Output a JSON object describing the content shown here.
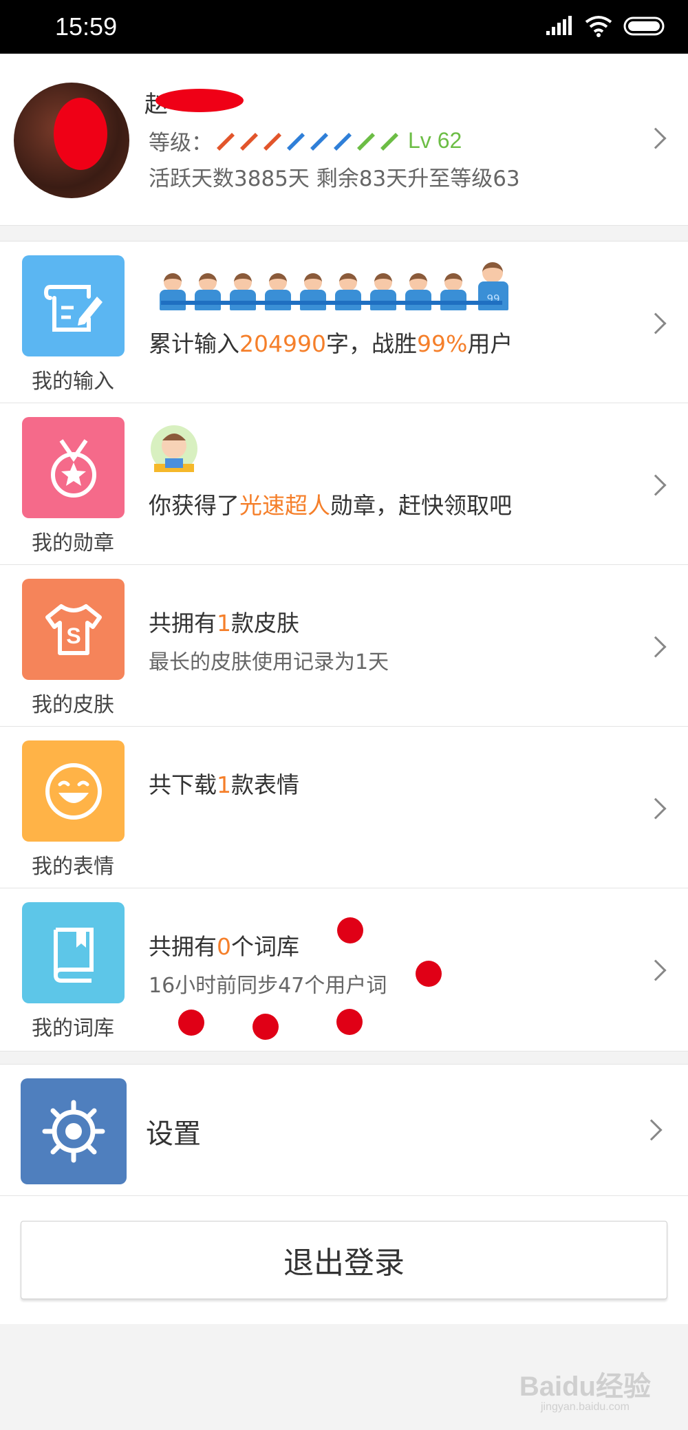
{
  "status_bar": {
    "time": "15:59"
  },
  "profile": {
    "name": "赵",
    "level_label": "等级：",
    "level_value": "Lv 62",
    "active_text": "活跃天数3885天 剩余83天升至等级63"
  },
  "menu": [
    {
      "label": "我的输入",
      "title_parts": [
        "累计输入",
        "204990",
        "字，战胜",
        "99%",
        "用户"
      ],
      "kid_badge": "99",
      "color": "#5bb6f2"
    },
    {
      "label": "我的勋章",
      "title_parts": [
        "你获得了",
        "光速超人",
        "勋章，赶快领取吧"
      ],
      "color": "#f56a8a"
    },
    {
      "label": "我的皮肤",
      "title_parts": [
        "共拥有",
        "1",
        "款皮肤"
      ],
      "subtitle": "最长的皮肤使用记录为1天",
      "color": "#f5845a"
    },
    {
      "label": "我的表情",
      "title_parts": [
        "共下载",
        "1",
        "款表情"
      ],
      "color": "#ffb347"
    },
    {
      "label": "我的词库",
      "title_parts": [
        "共拥有",
        "0",
        "个词库"
      ],
      "subtitle": "16小时前同步47个用户词",
      "color": "#5dc6e8"
    }
  ],
  "settings": {
    "label": "设置",
    "color": "#4f7fbe"
  },
  "logout": {
    "label": "退出登录"
  },
  "watermark": {
    "text": "Baidu经验",
    "sub": "jingyan.baidu.com"
  }
}
